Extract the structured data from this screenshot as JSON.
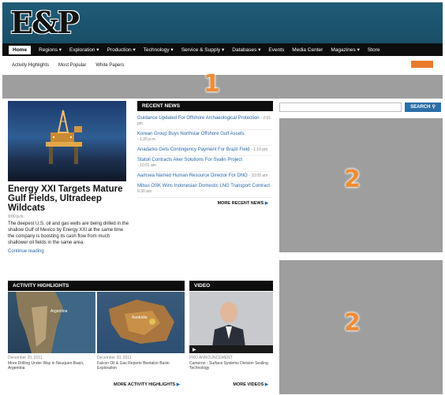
{
  "brand": {
    "logo_text": "E&P"
  },
  "nav": {
    "items": [
      "Home",
      "Regions ▾",
      "Exploration ▾",
      "Production ▾",
      "Technology ▾",
      "Service & Supply ▾",
      "Databases ▾",
      "Events",
      "Media Center",
      "Magazines ▾",
      "Store"
    ]
  },
  "subnav": {
    "items": [
      "Activity Highlights",
      "Most Popular",
      "White Papers"
    ]
  },
  "ads": {
    "top_marker": "1",
    "right_marker": "2"
  },
  "feature": {
    "headline": "Energy XXI Targets Mature Gulf Fields, Ultradeep Wildcats",
    "byline": "9:00 p.m.",
    "summary": "The deepest U.S. oil and gas wells are being drilled in the shallow Gulf of Mexico by Energy XXI at the same time the company is boosting its cash flow from much shallower oil fields in the same area.",
    "read_more": "Continue reading"
  },
  "recent_news": {
    "title": "RECENT NEWS",
    "items": [
      {
        "title": "Guidance Updated For Offshore Archaeological Protection",
        "time": "- 2:01 pm"
      },
      {
        "title": "Korean Group Buys Northstar Offshore Gulf Assets",
        "time": "- 1:20 p.m."
      },
      {
        "title": "Anadarko Gets Contingency Payment For Brazil Field",
        "time": "- 1:10 pm"
      },
      {
        "title": "Statoil Contracts Aker Solutions For Svalin Project",
        "time": "- 10:01 am"
      },
      {
        "title": "Aamsea Named Human Resource Director For DNO",
        "time": "- 10:00 am"
      },
      {
        "title": "Mitsui OSK Wins Indonesian Domestic LNG Transport Contract",
        "time": "- 9:30 am"
      }
    ],
    "more": "MORE RECENT NEWS"
  },
  "search": {
    "placeholder": "",
    "button": "SEARCH"
  },
  "activity": {
    "title": "ACTIVITY HIGHLIGHTS",
    "items": [
      {
        "date": "December 20, 2011",
        "caption": "More Drilling Under Way in Neuquen Basin, Argentina",
        "map_label": "Argentina"
      },
      {
        "date": "December 20, 2011",
        "caption": "Falcon Oil & Gas Reports Beetaloo Basin Exploration",
        "map_label": "Australia"
      }
    ],
    "more": "MORE ACTIVITY HIGHLIGHTS"
  },
  "video": {
    "title": "VIDEO",
    "tag": "PRO ANNOUNCEMENT",
    "caption": "Cameron - Surface Systems Division Sealing Technology",
    "more": "MORE VIDEOS"
  }
}
